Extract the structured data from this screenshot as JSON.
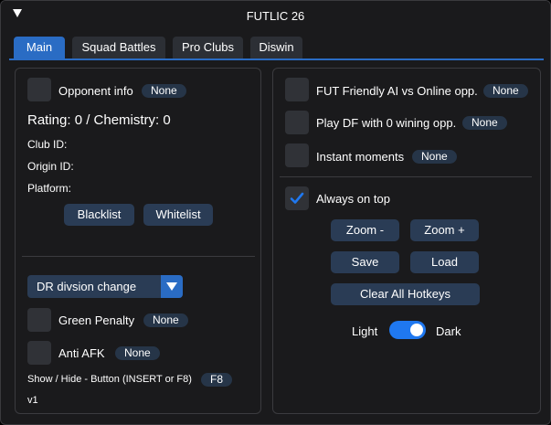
{
  "window": {
    "title": "FUTLIC 26"
  },
  "tabs": [
    {
      "label": "Main",
      "active": true
    },
    {
      "label": "Squad Battles",
      "active": false
    },
    {
      "label": "Pro Clubs",
      "active": false
    },
    {
      "label": "Diswin",
      "active": false
    }
  ],
  "left": {
    "opponent_info": {
      "label": "Opponent info",
      "hotkey": "None",
      "checked": false
    },
    "rating_line": "Rating: 0 / Chemistry: 0",
    "club_id": "Club ID:",
    "origin_id": "Origin ID:",
    "platform": "Platform:",
    "blacklist": "Blacklist",
    "whitelist": "Whitelist",
    "dropdown": {
      "selected": "DR divsion change"
    },
    "green_penalty": {
      "label": "Green Penalty",
      "hotkey": "None",
      "checked": false
    },
    "anti_afk": {
      "label": "Anti AFK",
      "hotkey": "None",
      "checked": false
    },
    "show_hide": {
      "label": "Show / Hide - Button (INSERT or F8)",
      "hotkey": "F8"
    },
    "version": "v1"
  },
  "right": {
    "fut_friendly": {
      "label": "FUT Friendly AI vs Online opp.",
      "hotkey": "None",
      "checked": false
    },
    "play_df": {
      "label": "Play DF with 0 wining opp.",
      "hotkey": "None",
      "checked": false
    },
    "instant_moments": {
      "label": "Instant moments",
      "hotkey": "None",
      "checked": false
    },
    "always_on_top": {
      "label": "Always on top",
      "checked": true
    },
    "zoom_out": "Zoom -",
    "zoom_in": "Zoom +",
    "save": "Save",
    "load": "Load",
    "clear_hotkeys": "Clear All Hotkeys",
    "theme": {
      "light_label": "Light",
      "dark_label": "Dark",
      "dark_enabled": true
    }
  },
  "colors": {
    "accent": "#2a6cc4",
    "toggle_on": "#1f78f0",
    "background": "#1a1a1c",
    "button": "#2a3c55"
  }
}
